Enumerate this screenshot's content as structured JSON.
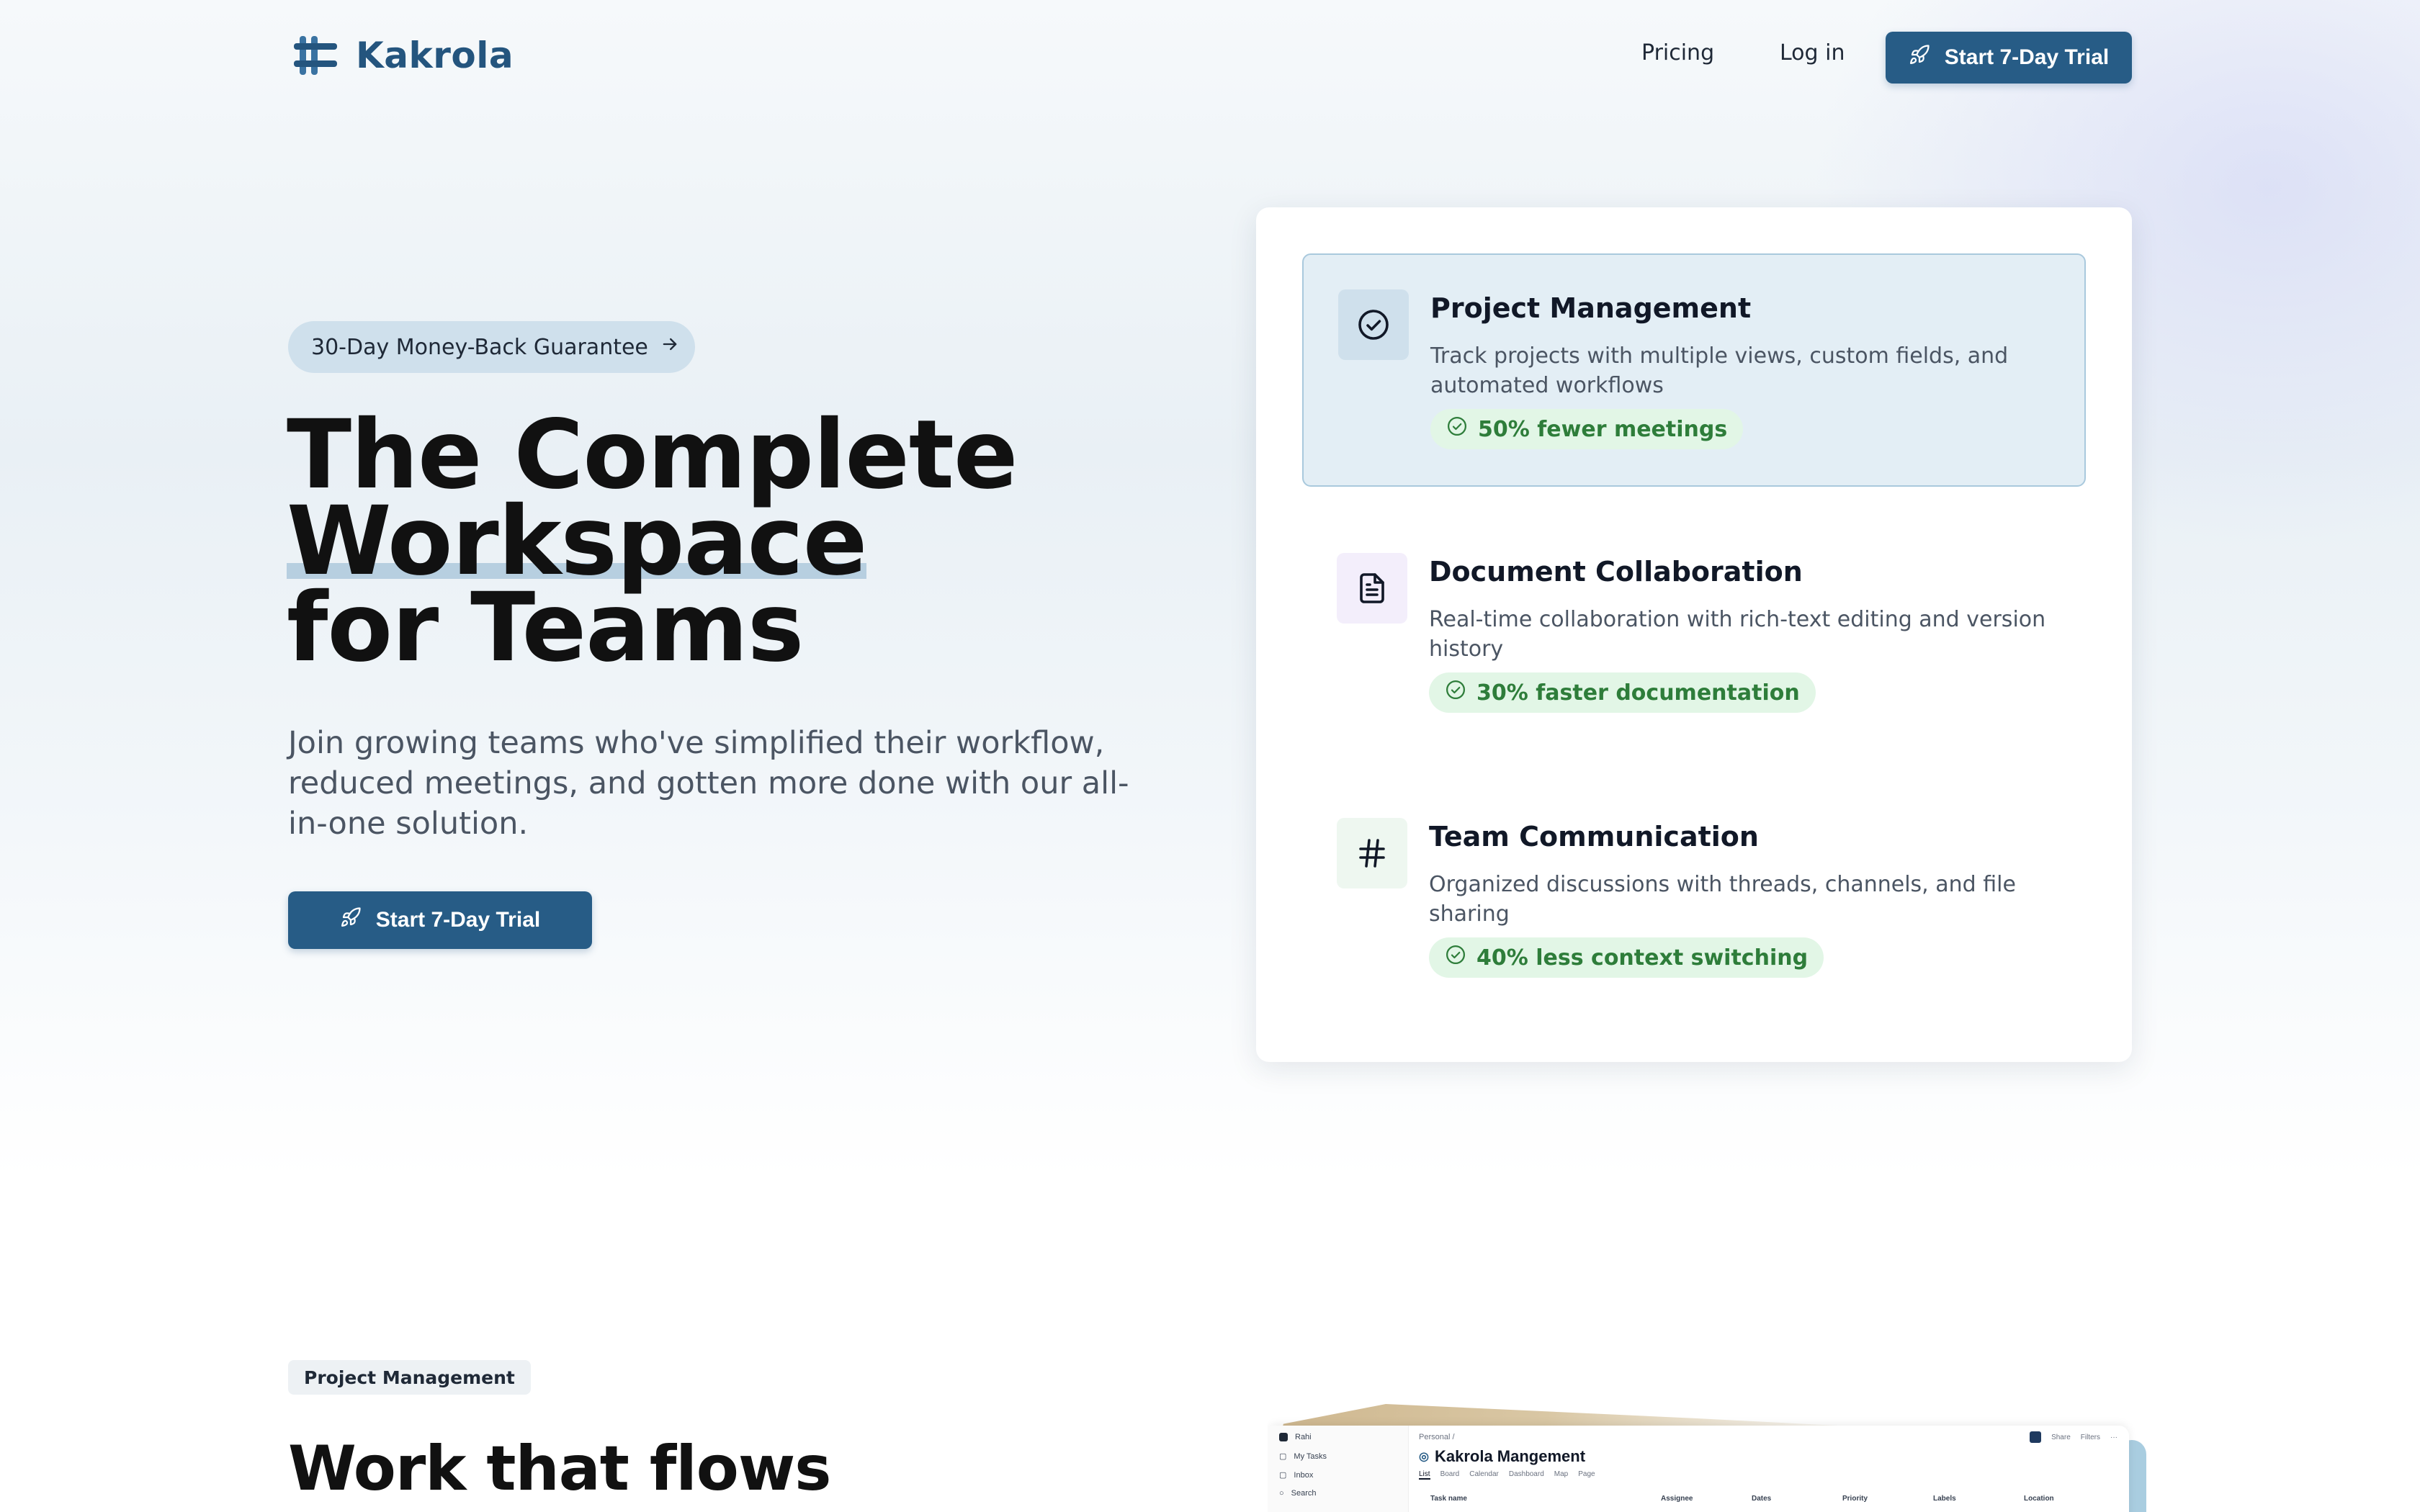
{
  "brand": {
    "name": "Kakrola",
    "accent": "#275c86"
  },
  "nav": {
    "pricing": "Pricing",
    "login": "Log in",
    "cta": "Start 7-Day Trial"
  },
  "hero": {
    "badge": "30-Day Money-Back Guarantee",
    "title_line1": "The Complete",
    "title_line2": "Workspace",
    "title_line3": "for Teams",
    "subtitle": "Join growing teams who've simplified their workflow, reduced meetings, and gotten more done with our all-in-one solution.",
    "cta": "Start 7-Day Trial"
  },
  "features": [
    {
      "title": "Project Management",
      "description": "Track projects with multiple views, custom fields, and automated workflows",
      "stat": "50% fewer meetings",
      "icon": "check-circle-icon",
      "active": true
    },
    {
      "title": "Document Collaboration",
      "description": "Real-time collaboration with rich-text editing and version history",
      "stat": "30% faster documentation",
      "icon": "document-icon",
      "active": false
    },
    {
      "title": "Team Communication",
      "description": "Organized discussions with threads, channels, and file sharing",
      "stat": "40% less context switching",
      "icon": "hash-icon",
      "active": false
    }
  ],
  "section2": {
    "badge": "Project Management",
    "title": "Work that flows"
  },
  "preview": {
    "workspace": "Rahi",
    "sidebar": [
      "My Tasks",
      "Inbox",
      "Search"
    ],
    "breadcrumb": "Personal /",
    "title": "Kakrola Mangement",
    "tabs": [
      "List",
      "Board",
      "Calendar",
      "Dashboard",
      "Map",
      "Page"
    ],
    "columns": [
      "Task name",
      "Assignee",
      "Dates",
      "Priority",
      "Labels",
      "Location"
    ],
    "tools": [
      "Share",
      "Filters",
      "···"
    ]
  }
}
